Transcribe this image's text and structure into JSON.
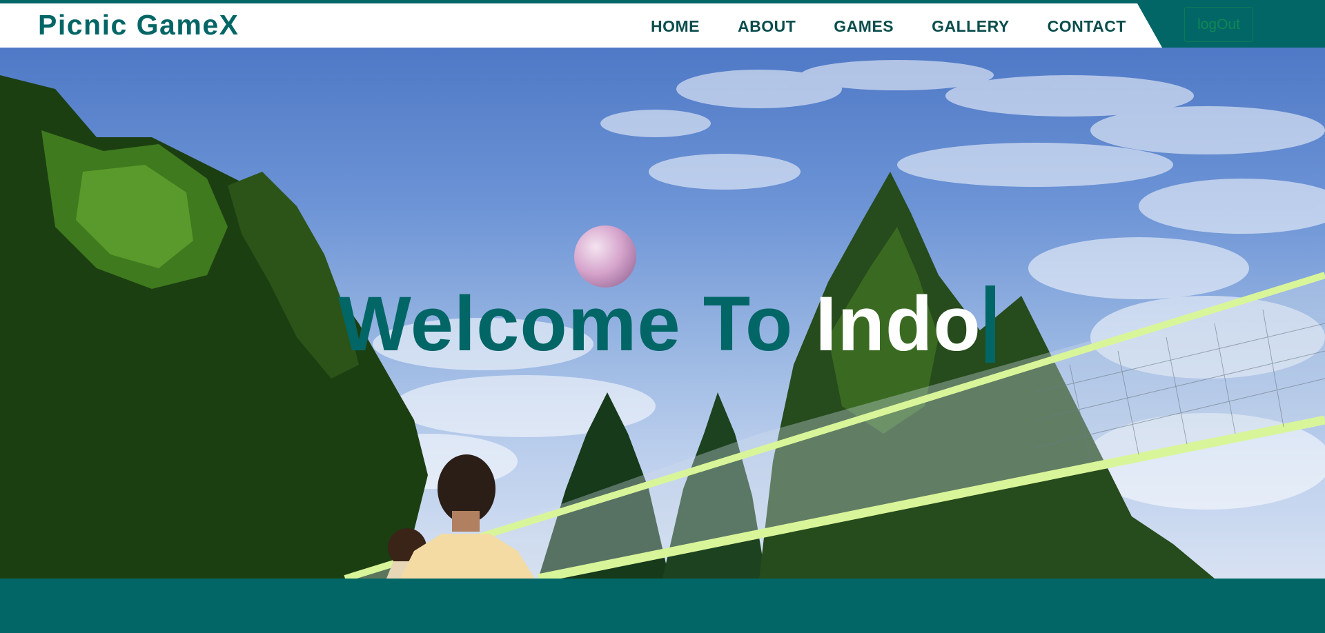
{
  "brand": {
    "name": "Picnic GameX"
  },
  "nav": {
    "links": [
      {
        "label": "HOME"
      },
      {
        "label": "ABOUT"
      },
      {
        "label": "GAMES"
      },
      {
        "label": "GALLERY"
      },
      {
        "label": "CONTACT"
      }
    ],
    "logout_label": "logOut"
  },
  "hero": {
    "title_green": "Welcome To ",
    "title_typed": "Indo"
  },
  "colors": {
    "primary": "#036666",
    "nav_text": "#0b4d4d",
    "logout_text": "#0c8a55",
    "hero_typed": "#ffffff"
  },
  "icons": {
    "typing_cursor": "vertical-bar"
  }
}
